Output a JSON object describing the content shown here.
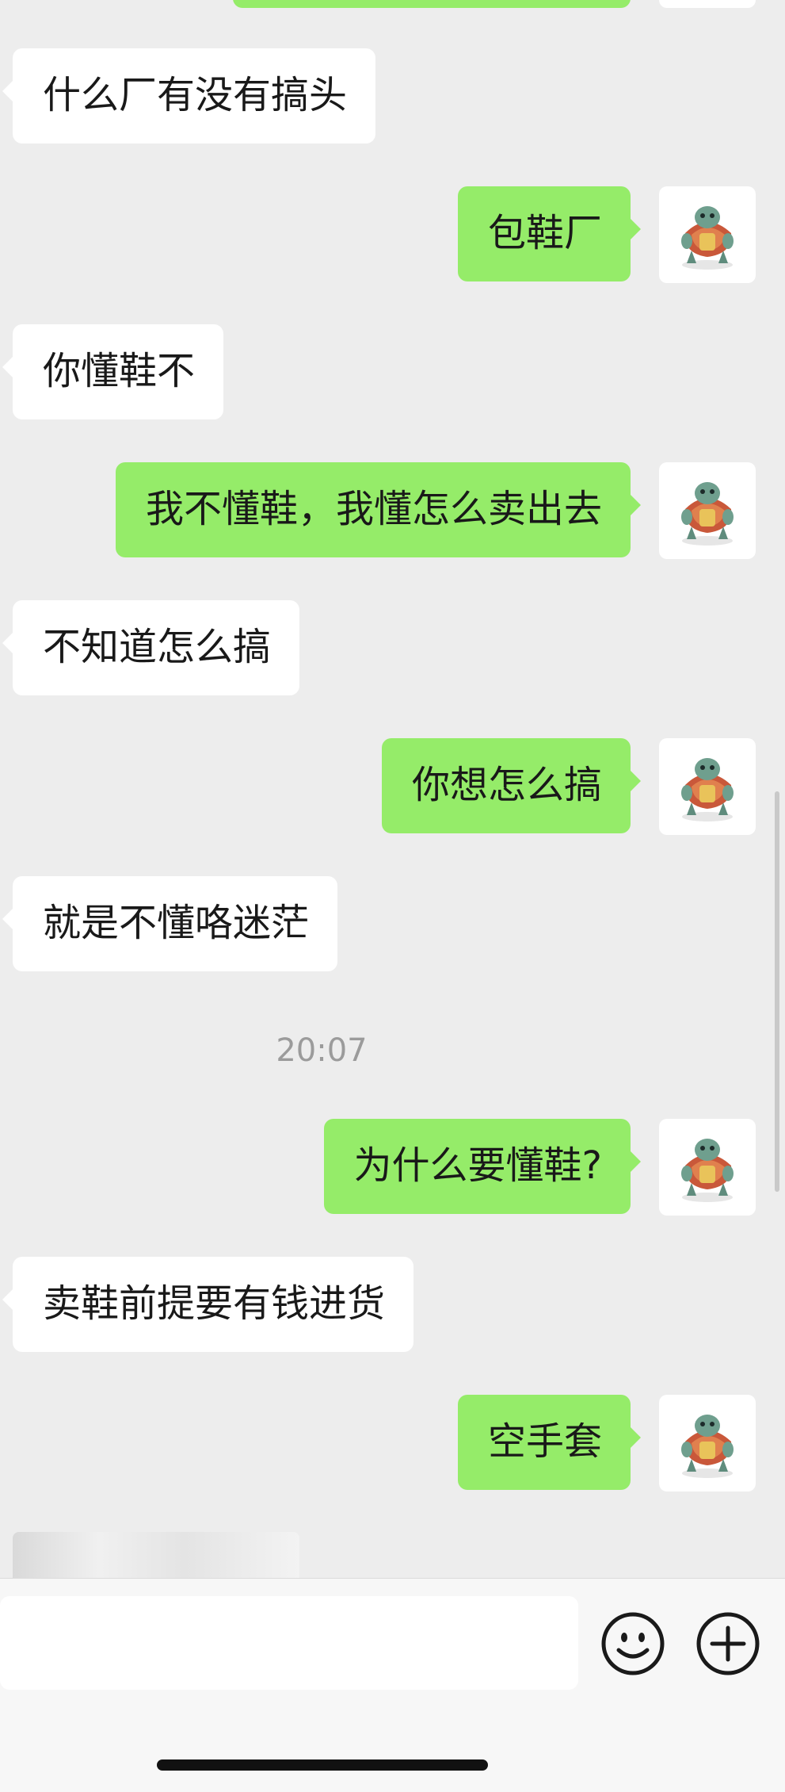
{
  "messages": [
    {
      "side": "left",
      "text": "什么厂有没有搞头"
    },
    {
      "side": "right",
      "text": "包鞋厂"
    },
    {
      "side": "left",
      "text": "你懂鞋不"
    },
    {
      "side": "right",
      "text": "我不懂鞋，我懂怎么卖出去"
    },
    {
      "side": "left",
      "text": "不知道怎么搞"
    },
    {
      "side": "right",
      "text": "你想怎么搞"
    },
    {
      "side": "left",
      "text": "就是不懂咯迷茫"
    },
    {
      "side": "right",
      "text": "为什么要懂鞋?"
    },
    {
      "side": "left",
      "text": "卖鞋前提要有钱进货"
    },
    {
      "side": "right",
      "text": "空手套"
    }
  ],
  "timestamp": "20:07",
  "avatar": {
    "icon": "turtle-avatar-icon"
  },
  "input_bar": {
    "emoji_icon": "emoji-icon",
    "add_icon": "plus-circle-icon"
  },
  "colors": {
    "background": "#ededed",
    "sent_bubble": "#95ec69",
    "received_bubble": "#ffffff"
  }
}
